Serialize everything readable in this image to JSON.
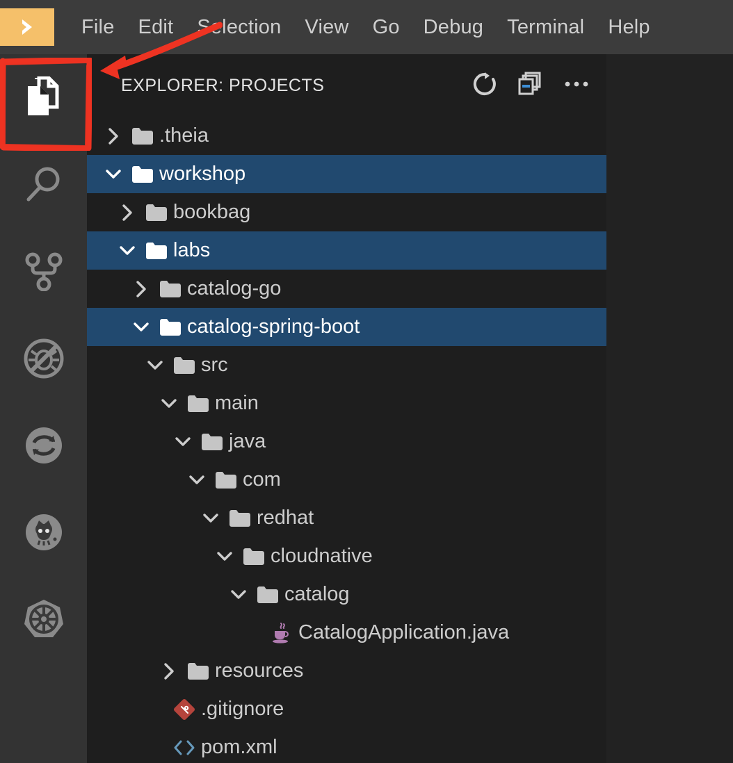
{
  "app": {
    "logo_icon": "chevron-right-logo",
    "logo_color": "#f5c06a",
    "accent_selection_color": "#21496f",
    "panel_background": "#1e1e1e",
    "menubar_background": "#3c3c3c",
    "activitybar_background": "#333333"
  },
  "menubar": {
    "items": [
      {
        "label": "File"
      },
      {
        "label": "Edit"
      },
      {
        "label": "Selection"
      },
      {
        "label": "View"
      },
      {
        "label": "Go"
      },
      {
        "label": "Debug"
      },
      {
        "label": "Terminal"
      },
      {
        "label": "Help"
      }
    ]
  },
  "activitybar": {
    "items": [
      {
        "name": "explorer",
        "icon": "files-icon",
        "active": true
      },
      {
        "name": "search",
        "icon": "search-icon",
        "active": false
      },
      {
        "name": "source-control",
        "icon": "git-branch-icon",
        "active": false
      },
      {
        "name": "debug",
        "icon": "debug-disabled-icon",
        "active": false
      },
      {
        "name": "sync",
        "icon": "sync-circle-icon",
        "active": false
      },
      {
        "name": "github",
        "icon": "octocat-icon",
        "active": false
      },
      {
        "name": "kubernetes",
        "icon": "kubernetes-helm-icon",
        "active": false
      }
    ]
  },
  "explorer": {
    "title": "EXPLORER: PROJECTS",
    "actions": [
      {
        "name": "refresh",
        "icon": "refresh-icon",
        "tooltip": "Refresh"
      },
      {
        "name": "collapse-all",
        "icon": "collapse-all-icon",
        "tooltip": "Collapse All"
      },
      {
        "name": "more",
        "icon": "ellipsis-icon",
        "tooltip": "More Actions..."
      }
    ],
    "tree": [
      {
        "label": ".theia",
        "depth": 0,
        "type": "folder",
        "state": "collapsed",
        "selected": false,
        "icon": "folder-icon"
      },
      {
        "label": "workshop",
        "depth": 0,
        "type": "folder",
        "state": "expanded",
        "selected": true,
        "icon": "folder-icon"
      },
      {
        "label": "bookbag",
        "depth": 1,
        "type": "folder",
        "state": "collapsed",
        "selected": false,
        "icon": "folder-icon"
      },
      {
        "label": "labs",
        "depth": 1,
        "type": "folder",
        "state": "expanded",
        "selected": true,
        "icon": "folder-icon"
      },
      {
        "label": "catalog-go",
        "depth": 2,
        "type": "folder",
        "state": "collapsed",
        "selected": false,
        "icon": "folder-icon"
      },
      {
        "label": "catalog-spring-boot",
        "depth": 2,
        "type": "folder",
        "state": "expanded",
        "selected": true,
        "icon": "folder-icon"
      },
      {
        "label": "src",
        "depth": 3,
        "type": "folder",
        "state": "expanded",
        "selected": false,
        "icon": "folder-icon"
      },
      {
        "label": "main",
        "depth": 4,
        "type": "folder",
        "state": "expanded",
        "selected": false,
        "icon": "folder-icon"
      },
      {
        "label": "java",
        "depth": 5,
        "type": "folder",
        "state": "expanded",
        "selected": false,
        "icon": "folder-icon"
      },
      {
        "label": "com",
        "depth": 6,
        "type": "folder",
        "state": "expanded",
        "selected": false,
        "icon": "folder-icon"
      },
      {
        "label": "redhat",
        "depth": 7,
        "type": "folder",
        "state": "expanded",
        "selected": false,
        "icon": "folder-icon"
      },
      {
        "label": "cloudnative",
        "depth": 8,
        "type": "folder",
        "state": "expanded",
        "selected": false,
        "icon": "folder-icon"
      },
      {
        "label": "catalog",
        "depth": 9,
        "type": "folder",
        "state": "expanded",
        "selected": false,
        "icon": "folder-icon"
      },
      {
        "label": "CatalogApplication.java",
        "depth": 10,
        "type": "file",
        "state": "leaf",
        "selected": false,
        "icon": "java-icon"
      },
      {
        "label": "resources",
        "depth": 4,
        "type": "folder",
        "state": "collapsed",
        "selected": false,
        "icon": "folder-icon"
      },
      {
        "label": ".gitignore",
        "depth": 3,
        "type": "file",
        "state": "leaf",
        "selected": false,
        "icon": "git-icon"
      },
      {
        "label": "pom.xml",
        "depth": 3,
        "type": "file",
        "state": "leaf",
        "selected": false,
        "icon": "xml-icon"
      }
    ]
  },
  "annotations": {
    "color": "#ee3322",
    "highlight_box": {
      "target": "explorer-activity-icon"
    },
    "arrow": {
      "points_to": "explorer-activity-icon"
    }
  }
}
